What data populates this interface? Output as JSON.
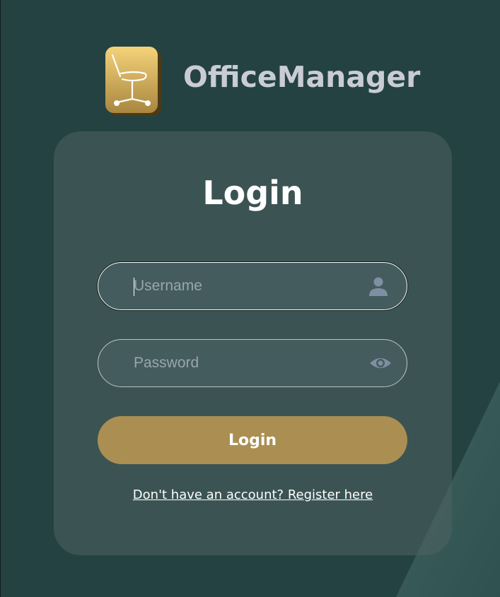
{
  "app": {
    "name": "OfficeManager",
    "logo_icon": "office-chair-icon"
  },
  "login_card": {
    "title": "Login",
    "username": {
      "value": "",
      "placeholder": "Username",
      "icon": "user-icon"
    },
    "password": {
      "value": "",
      "placeholder": "Password",
      "icon": "eye-icon"
    },
    "submit_label": "Login",
    "register_link": "Don't have an account? Register here"
  },
  "colors": {
    "background": "#244241",
    "card": "#3a5253",
    "accent_button": "#ab8f52",
    "brand_text": "#c9ccd6",
    "logo_gold": "#d8b45f"
  }
}
